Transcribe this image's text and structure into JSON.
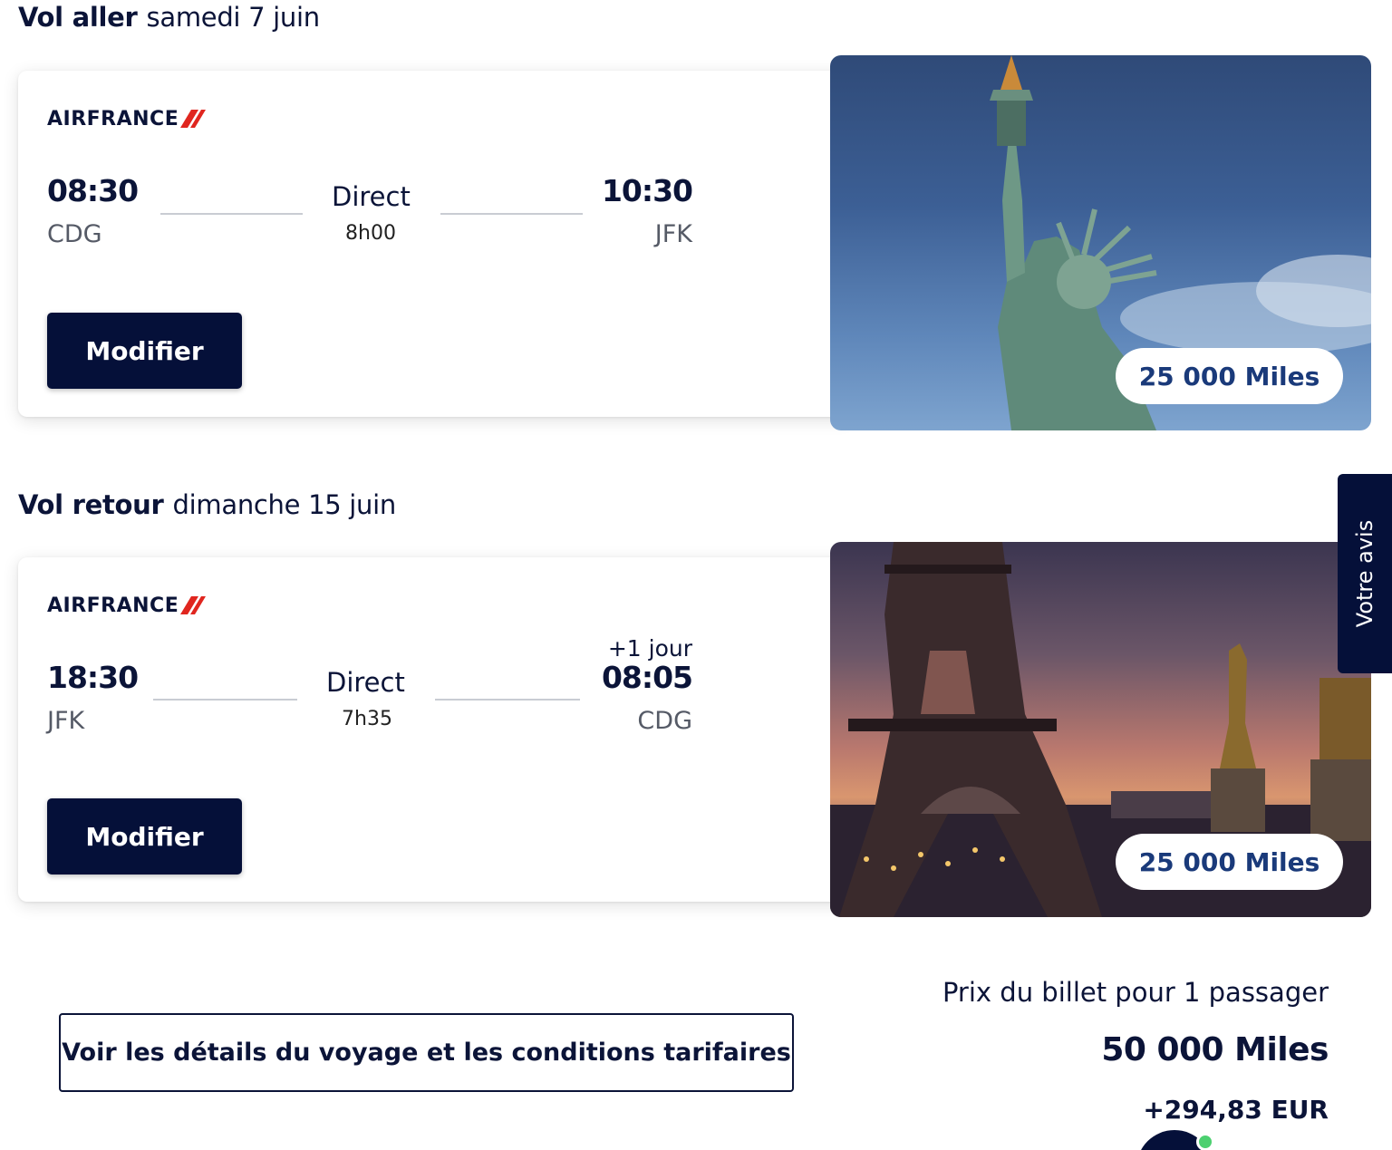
{
  "outbound": {
    "label": "Vol aller",
    "date": "samedi 7 juin",
    "airline": "AIRFRANCE",
    "departure_time": "08:30",
    "departure_airport": "CDG",
    "stops": "Direct",
    "duration": "8h00",
    "arrival_time": "10:30",
    "arrival_airport": "JFK",
    "modify_label": "Modifier",
    "miles": "25 000  Miles"
  },
  "return": {
    "label": "Vol retour",
    "date": "dimanche 15 juin",
    "airline": "AIRFRANCE",
    "departure_time": "18:30",
    "departure_airport": "JFK",
    "stops": "Direct",
    "duration": "7h35",
    "day_offset": "+1 jour",
    "arrival_time": "08:05",
    "arrival_airport": "CDG",
    "modify_label": "Modifier",
    "miles": "25 000  Miles"
  },
  "feedback_tab": "Votre avis",
  "details_link": "Voir les détails du voyage et les conditions tarifaires",
  "price": {
    "caption": "Prix du billet pour 1 passager",
    "miles": "50 000  Miles",
    "surcharge": "+294,83 EUR"
  },
  "colors": {
    "navy": "#051039",
    "airfrance_red": "#e0261f",
    "miles_blue": "#1a3a7a",
    "online_green": "#4cd070"
  },
  "icons": {
    "chat": "chat-bubble-icon"
  }
}
